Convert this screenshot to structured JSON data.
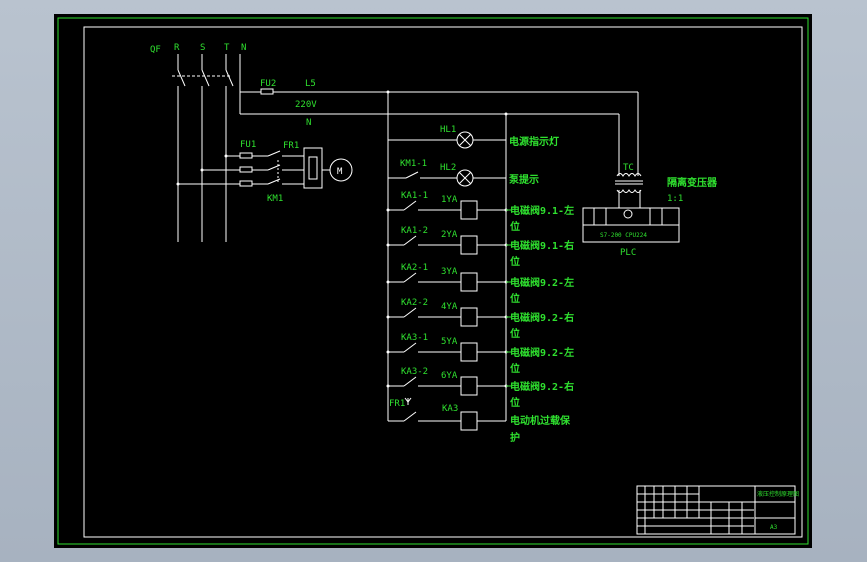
{
  "colors": {
    "page_bg": "#b0bac7",
    "sheet_bg": "#000000",
    "wire": "#ffffff",
    "text": "#2fe02f"
  },
  "power": {
    "phases": [
      "QF",
      "R",
      "S",
      "T",
      "N"
    ],
    "fu2": "FU2",
    "l5": "L5",
    "voltage": "220V",
    "n": "N",
    "fu1": "FU1",
    "fr1": "FR1",
    "motor": "M",
    "km1": "KM1"
  },
  "indicators": [
    {
      "lamp": "HL1",
      "desc": "电源指示灯",
      "contact": ""
    },
    {
      "lamp": "HL2",
      "desc": "泵提示",
      "contact": "KM1-1"
    }
  ],
  "valves": [
    {
      "contact": "KA1-1",
      "coil": "1YA",
      "desc1": "电磁阀9.1-左",
      "desc2": "位"
    },
    {
      "contact": "KA1-2",
      "coil": "2YA",
      "desc1": "电磁阀9.1-右",
      "desc2": "位"
    },
    {
      "contact": "KA2-1",
      "coil": "3YA",
      "desc1": "电磁阀9.2-左",
      "desc2": "位"
    },
    {
      "contact": "KA2-2",
      "coil": "4YA",
      "desc1": "电磁阀9.2-右",
      "desc2": "位"
    },
    {
      "contact": "KA3-1",
      "coil": "5YA",
      "desc1": "电磁阀9.2-左",
      "desc2": "位"
    },
    {
      "contact": "KA3-2",
      "coil": "6YA",
      "desc1": "电磁阀9.2-右",
      "desc2": "位"
    }
  ],
  "overload": {
    "contact": "FR1",
    "coil": "KA3",
    "desc1": "电动机过载保",
    "desc2": "护"
  },
  "transformer": {
    "label": "TC",
    "title": "隔离变压器",
    "ratio": "1:1"
  },
  "plc": {
    "label": "PLC",
    "inner": "S7-200 CPU224"
  },
  "title_block": {
    "drawing_title": "液压控制原理图",
    "size": "A3"
  }
}
